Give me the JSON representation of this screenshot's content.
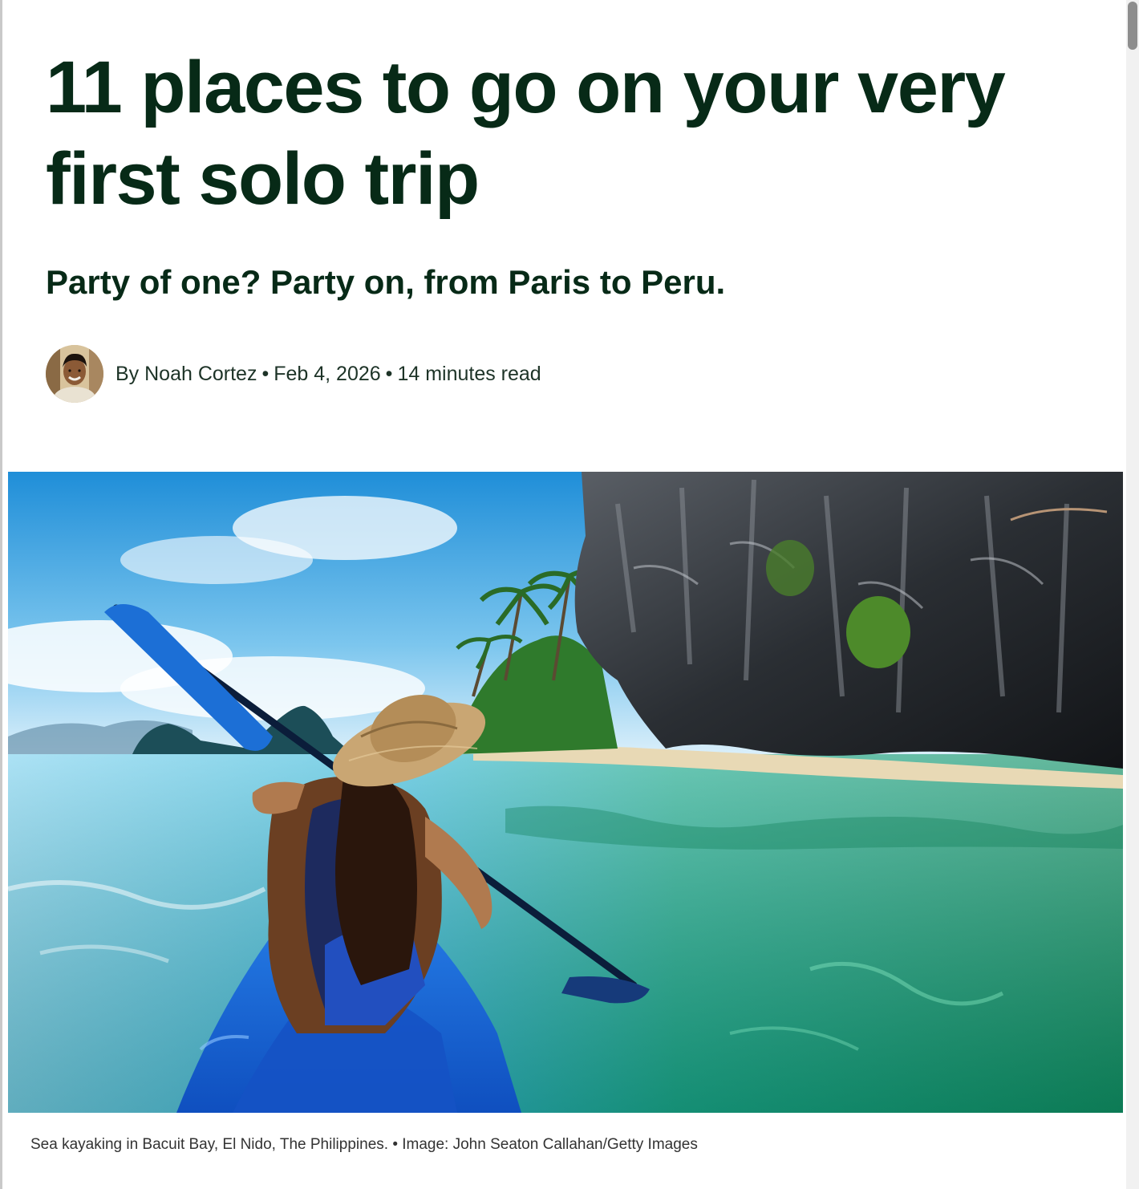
{
  "article": {
    "headline": "11 places to go on your very first solo trip",
    "dek": "Party of one? Party on, from Paris to Peru.",
    "byline": {
      "author": "By Noah Cortez",
      "date": "Feb 4, 2026",
      "read_time": "14 minutes read",
      "separator": "•"
    },
    "hero_image": {
      "caption": "Sea kayaking in Bacuit Bay, El Nido, The Philippines. • Image: John Seaton Callahan/Getty Images"
    }
  },
  "colors": {
    "headline": "#072a17",
    "text": "#1d3327",
    "caption": "#333333",
    "water": "#17b08a",
    "sky": "#3fa9e0",
    "kayak": "#1c6fd6"
  }
}
